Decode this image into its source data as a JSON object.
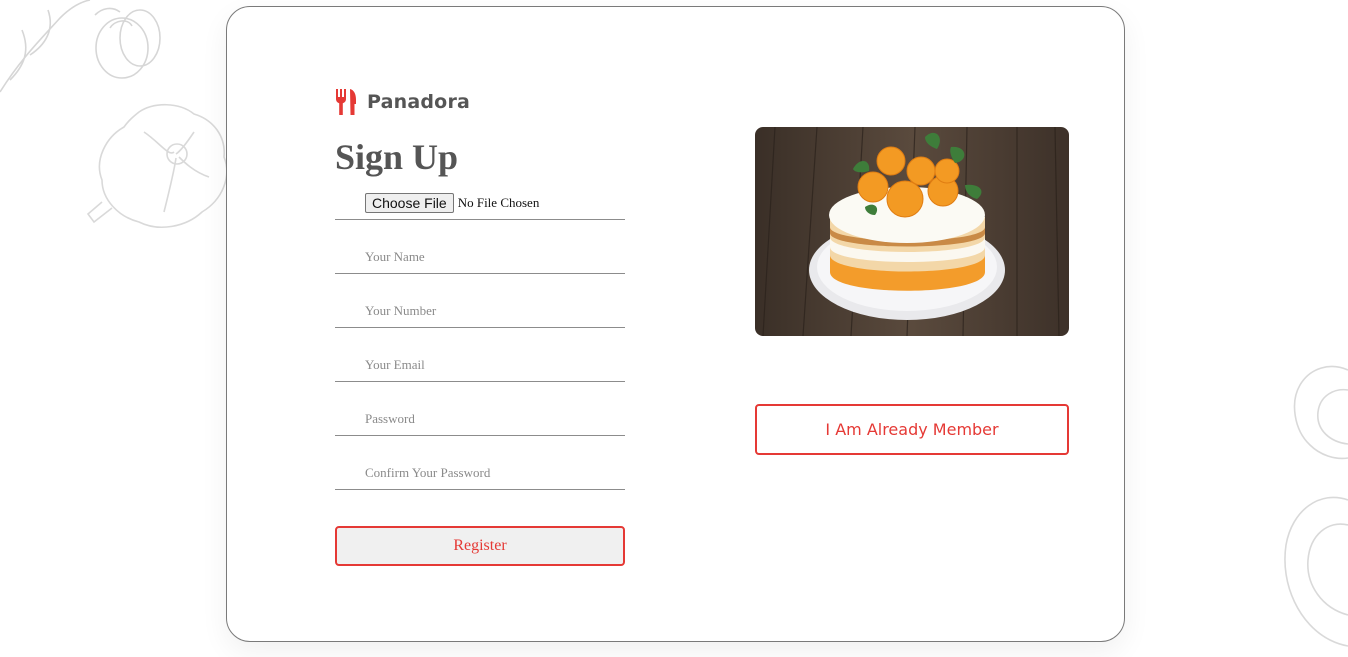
{
  "brand": {
    "name": "Panadora",
    "icon": "utensils-icon",
    "accent_color": "#e53935"
  },
  "title": "Sign Up",
  "form": {
    "file_button_label": "Choose File",
    "file_status": "No File Chosen",
    "name_placeholder": "Your Name",
    "number_placeholder": "Your Number",
    "email_placeholder": "Your Email",
    "password_placeholder": "Password",
    "confirm_password_placeholder": "Confirm Your Password",
    "register_label": "Register"
  },
  "side": {
    "image": "orange-cake-photo",
    "member_label": "I Am Already Member"
  }
}
